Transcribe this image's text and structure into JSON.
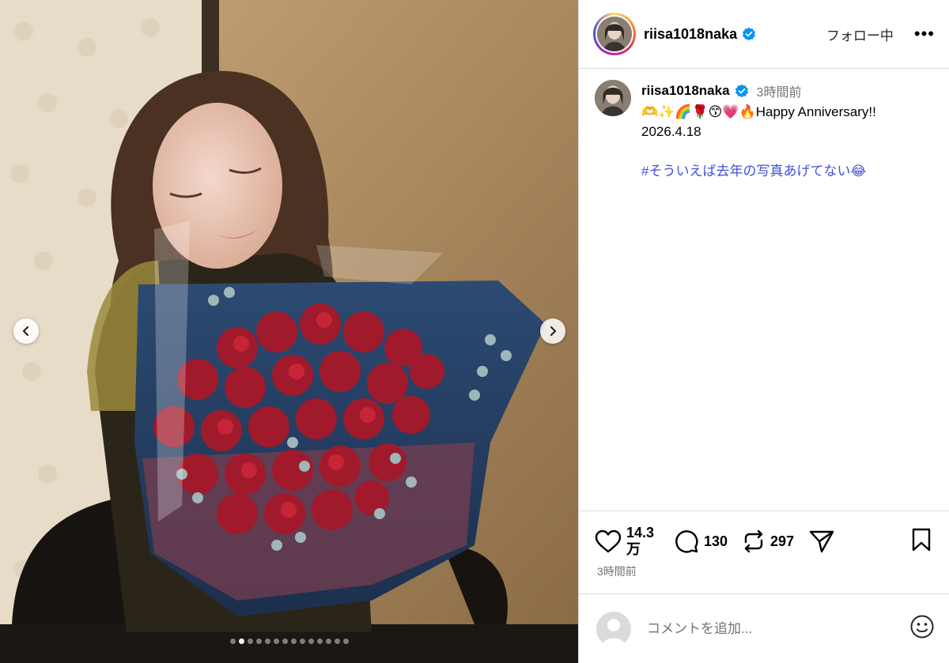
{
  "post": {
    "username": "riisa1018naka",
    "verified": true,
    "follow_label": "フォロー中",
    "more_label": "•••"
  },
  "caption": {
    "username": "riisa1018naka",
    "time": "3時間前",
    "line1": "🫶✨🌈🌹😙💗🔥Happy Anniversary!!",
    "line2": "2026.4.18",
    "hashtag": "#そういえば去年の写真あげてない😂"
  },
  "actions": {
    "likes_line1": "14.3",
    "likes_line2": "万",
    "comments": "130",
    "reposts": "297",
    "posted": "3時間前"
  },
  "comment_box": {
    "placeholder": "コメントを追加..."
  },
  "carousel": {
    "total": 14,
    "active_index": 1
  },
  "icons": {
    "like": "heart-icon",
    "comment": "comment-bubble-icon",
    "repost": "repost-icon",
    "share": "send-icon",
    "save": "bookmark-icon",
    "emoji": "emoji-icon",
    "prev": "chevron-left-icon",
    "next": "chevron-right-icon",
    "verified": "verified-badge-icon"
  },
  "colors": {
    "hashtag": "#4150d8",
    "verified": "#0095f6",
    "muted": "#737373"
  }
}
